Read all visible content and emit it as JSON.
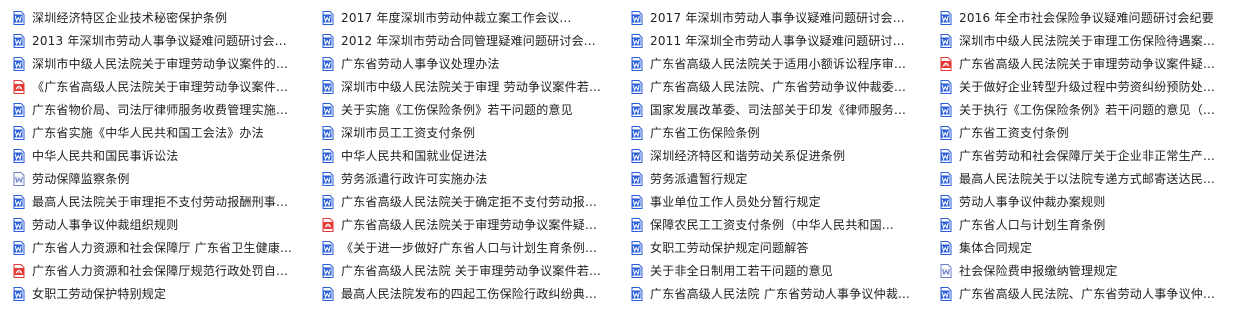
{
  "colors": {
    "word": "#2b5fd9",
    "wps": "#6a7fc4",
    "pdf": "#e53935"
  },
  "documents": [
    {
      "title": "深圳经济特区企业技术秘密保护条例",
      "icon": "word-doc-icon"
    },
    {
      "title": "2017 年度深圳市劳动仲裁立案工作会议...",
      "icon": "word-doc-icon"
    },
    {
      "title": "2017 年深圳市劳动人事争议疑难问题研讨会...",
      "icon": "word-doc-icon"
    },
    {
      "title": "2016 年全市社会保险争议疑难问题研讨会纪要",
      "icon": "word-doc-icon"
    },
    {
      "title": "2013 年深圳市劳动人事争议疑难问题研讨会...",
      "icon": "word-doc-icon"
    },
    {
      "title": "2012 年深圳市劳动合同管理疑难问题研讨会...",
      "icon": "word-doc-icon"
    },
    {
      "title": "2011 年深圳全市劳动人事争议疑难问题研讨...",
      "icon": "word-doc-icon"
    },
    {
      "title": "深圳市中级人民法院关于审理工伤保险待遇案...",
      "icon": "word-doc-icon"
    },
    {
      "title": "深圳市中级人民法院关于审理劳动争议案件的...",
      "icon": "word-doc-icon"
    },
    {
      "title": "广东省劳动人事争议处理办法",
      "icon": "word-doc-icon"
    },
    {
      "title": "广东省高级人民法院关于适用小额诉讼程序审...",
      "icon": "word-doc-icon"
    },
    {
      "title": "广东省高级人民法院关于审理劳动争议案件疑...",
      "icon": "pdf-doc-icon"
    },
    {
      "title": "《广东省高级人民法院关于审理劳动争议案件...",
      "icon": "pdf-doc-icon"
    },
    {
      "title": "深圳市中级人民法院关于审理 劳动争议案件若...",
      "icon": "word-doc-icon"
    },
    {
      "title": "广东省高级人民法院、广东省劳动争议仲裁委...",
      "icon": "word-doc-icon"
    },
    {
      "title": "关于做好企业转型升级过程中劳资纠纷预防处...",
      "icon": "word-doc-icon"
    },
    {
      "title": "广东省物价局、司法厅律师服务收费管理实施...",
      "icon": "word-doc-icon"
    },
    {
      "title": "关于实施《工伤保险条例》若干问题的意见",
      "icon": "word-doc-icon"
    },
    {
      "title": "国家发展改革委、司法部关于印发《律师服务...",
      "icon": "word-doc-icon"
    },
    {
      "title": "关于执行《工伤保险条例》若干问题的意见（...",
      "icon": "word-doc-icon"
    },
    {
      "title": "广东省实施《中华人民共和国工会法》办法",
      "icon": "word-doc-icon"
    },
    {
      "title": "深圳市员工工资支付条例",
      "icon": "word-doc-icon"
    },
    {
      "title": "广东省工伤保险条例",
      "icon": "word-doc-icon"
    },
    {
      "title": "广东省工资支付条例",
      "icon": "word-doc-icon"
    },
    {
      "title": "中华人民共和国民事诉讼法",
      "icon": "word-doc-icon"
    },
    {
      "title": "中华人民共和国就业促进法",
      "icon": "word-doc-icon"
    },
    {
      "title": "深圳经济特区和谐劳动关系促进条例",
      "icon": "word-doc-icon"
    },
    {
      "title": "广东省劳动和社会保障厅关于企业非正常生产...",
      "icon": "word-doc-icon"
    },
    {
      "title": "劳动保障监察条例",
      "icon": "wps-doc-icon"
    },
    {
      "title": "劳务派遣行政许可实施办法",
      "icon": "word-doc-icon"
    },
    {
      "title": "劳务派遣暂行规定",
      "icon": "word-doc-icon"
    },
    {
      "title": "最高人民法院关于以法院专递方式邮寄送达民...",
      "icon": "word-doc-icon"
    },
    {
      "title": "最高人民法院关于审理拒不支付劳动报酬刑事...",
      "icon": "word-doc-icon"
    },
    {
      "title": "广东省高级人民法院关于确定拒不支付劳动报...",
      "icon": "word-doc-icon"
    },
    {
      "title": "事业单位工作人员处分暂行规定",
      "icon": "word-doc-icon"
    },
    {
      "title": "劳动人事争议仲裁办案规则",
      "icon": "word-doc-icon"
    },
    {
      "title": "劳动人事争议仲裁组织规则",
      "icon": "word-doc-icon"
    },
    {
      "title": "广东省高级人民法院关于审理劳动争议案件疑...",
      "icon": "pdf-doc-icon"
    },
    {
      "title": "保障农民工工资支付条例（中华人民共和国...",
      "icon": "word-doc-icon"
    },
    {
      "title": "广东省人口与计划生育条例",
      "icon": "word-doc-icon"
    },
    {
      "title": "广东省人力资源和社会保障厅 广东省卫生健康...",
      "icon": "word-doc-icon"
    },
    {
      "title": "《关于进一步做好广东省人口与计划生育条例...",
      "icon": "word-doc-icon"
    },
    {
      "title": "女职工劳动保护规定问题解答",
      "icon": "word-doc-icon"
    },
    {
      "title": "集体合同规定",
      "icon": "word-doc-icon"
    },
    {
      "title": "广东省人力资源和社会保障厅规范行政处罚自...",
      "icon": "pdf-doc-icon"
    },
    {
      "title": "广东省高级人民法院 关于审理劳动争议案件若...",
      "icon": "word-doc-icon"
    },
    {
      "title": "关于非全日制用工若干问题的意见",
      "icon": "word-doc-icon"
    },
    {
      "title": "社会保险费申报缴纳管理规定",
      "icon": "wps-doc-icon"
    },
    {
      "title": "女职工劳动保护特别规定",
      "icon": "word-doc-icon"
    },
    {
      "title": "最高人民法院发布的四起工伤保险行政纠纷典...",
      "icon": "word-doc-icon"
    },
    {
      "title": "广东省高级人民法院 广东省劳动人事争议仲裁...",
      "icon": "word-doc-icon"
    },
    {
      "title": "广东省高级人民法院、广东省劳动人事争议仲...",
      "icon": "word-doc-icon"
    }
  ]
}
